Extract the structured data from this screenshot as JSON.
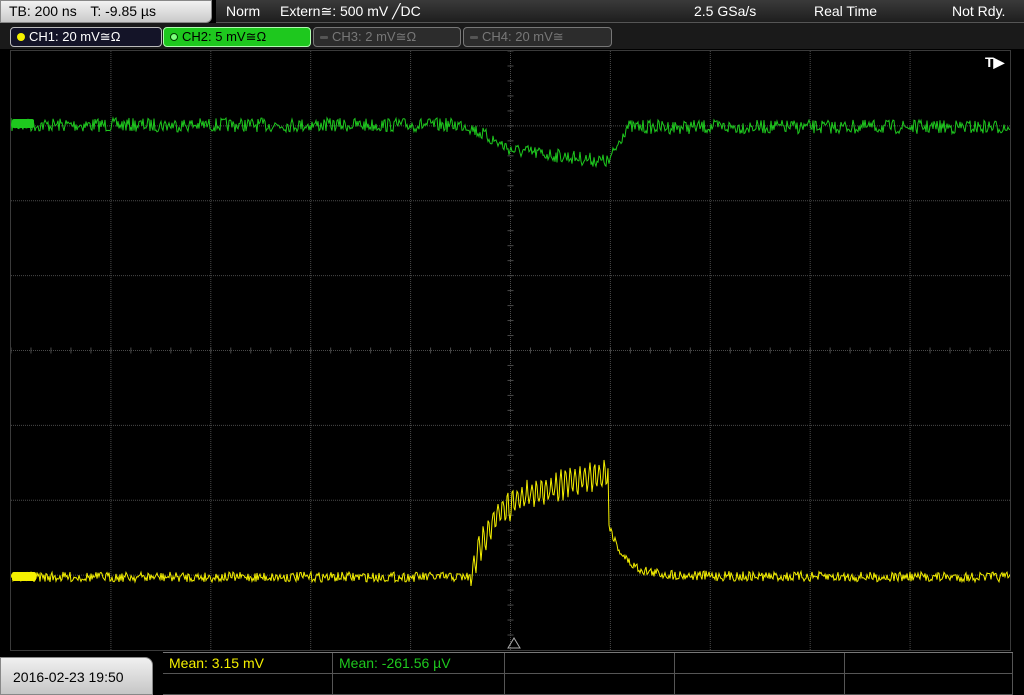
{
  "top_left": {
    "timebase": "TB: 200 ns",
    "trigger_time": "T: -9.85 µs"
  },
  "status_bar": {
    "mode": "Norm",
    "trigger_source": "Extern≅: 500 mV ╱DC",
    "sample_rate": "2.5 GSa/s",
    "acquisition": "Real Time",
    "state": "Not Rdy."
  },
  "channels": [
    {
      "label": "CH1: 20 mV≅Ω",
      "color": "#f5f000",
      "active": true
    },
    {
      "label": "CH2: 5 mV≅Ω",
      "color": "#1ec81e",
      "active": true
    },
    {
      "label": "CH3: 2 mV≅Ω",
      "color": "#777777",
      "active": false
    },
    {
      "label": "CH4: 20 mV≅",
      "color": "#777777",
      "active": false
    }
  ],
  "trigger_marker": "T▶",
  "datetime": "2016-02-23 19:50",
  "measurements": [
    {
      "label": "Mean: 3.15 mV",
      "color": "#f5f000"
    },
    {
      "label": "Mean: -261.56 µV",
      "color": "#1ec81e"
    }
  ],
  "colors": {
    "ch1": "#f5f000",
    "ch2": "#1ec81e",
    "grid": "#4a4a4a"
  }
}
